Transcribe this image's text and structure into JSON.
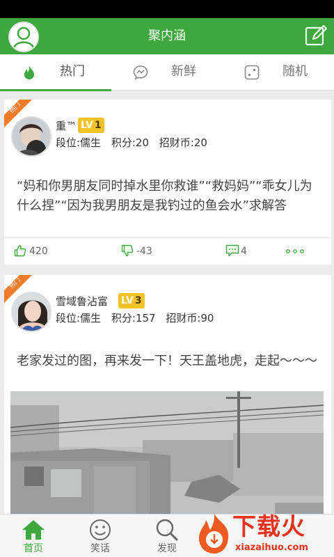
{
  "header": {
    "title": "聚内涵"
  },
  "tabs": [
    {
      "label": "热门",
      "icon": "flame-icon",
      "active": true
    },
    {
      "label": "新鲜",
      "icon": "chat-bubble-icon",
      "active": false
    },
    {
      "label": "随机",
      "icon": "dice-icon",
      "active": false
    }
  ],
  "posts": [
    {
      "ribbon": "热门",
      "username": "重™",
      "level_prefix": "LV",
      "level": "1",
      "rank": "段位:儒生",
      "points": "积分:20",
      "coins": "招财币:20",
      "text": "“妈和你男朋友同时掉水里你救谁”“救妈妈”“乖女儿为什么捏”“因为我男朋友是我钓过的鱼会水”求解答",
      "likes": "420",
      "dislikes": "-43",
      "comments": "4"
    },
    {
      "ribbon": "热门",
      "username": "雪域鲁沾富",
      "level_prefix": "LV",
      "level": "3",
      "rank": "段位:儒生",
      "points": "积分:157",
      "coins": "招财币:90",
      "text": "老家发过的图，再来发一下！天王盖地虎，走起〜〜〜"
    }
  ],
  "nav": [
    {
      "label": "首页",
      "icon": "home-icon",
      "active": true
    },
    {
      "label": "笑话",
      "icon": "smiley-icon",
      "active": false
    },
    {
      "label": "发现",
      "icon": "search-icon",
      "active": false
    }
  ],
  "watermark": {
    "text": "下载火",
    "sub": "xiazaihuo.com"
  },
  "colors": {
    "primary": "#3ea83e",
    "ribbon": "#f07c2a",
    "badge": "#f6c327",
    "watermark": "#e8321e"
  }
}
